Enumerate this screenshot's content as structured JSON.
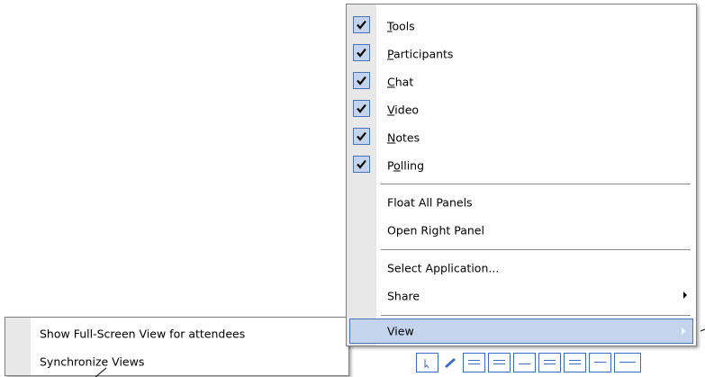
{
  "view_menu": {
    "items": [
      {
        "label": "Tools",
        "mnemonic": "T",
        "checked": true
      },
      {
        "label": "Participants",
        "mnemonic": "P",
        "checked": true
      },
      {
        "label": "Chat",
        "mnemonic": "C",
        "checked": true
      },
      {
        "label": "Video",
        "mnemonic": "V",
        "checked": true
      },
      {
        "label": "Notes",
        "mnemonic": "N",
        "checked": true
      },
      {
        "label": "Polling",
        "mnemonic": "o",
        "checked": true
      }
    ],
    "float_all_panels": "Float All Panels",
    "open_right_panel": "Open Right Panel",
    "select_application": "Select Application...",
    "share": "Share",
    "view": "View"
  },
  "share_submenu": {
    "show_fullscreen": "Show Full-Screen View for attendees",
    "synchronize_views": "Synchronize Views"
  },
  "colors": {
    "check_fill": "#c3d4ec",
    "highlight_border": "#4b74b8",
    "gutter": "#e8e8e8"
  },
  "icons": {
    "checkmark": "check-icon",
    "submenu_arrow": "submenu-arrow-icon"
  }
}
